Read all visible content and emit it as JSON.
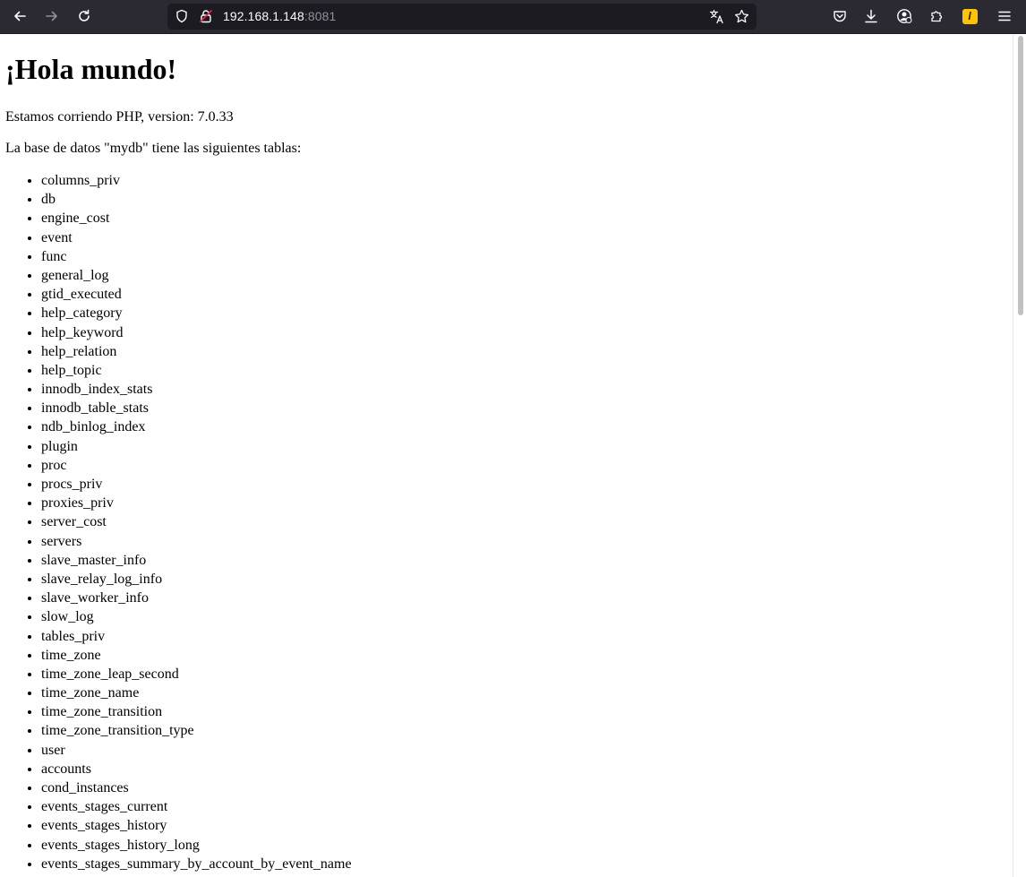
{
  "browser": {
    "url_host": "192.168.1.148",
    "url_port": ":8081",
    "icons": {
      "back": "back-arrow-icon",
      "forward": "forward-arrow-icon",
      "reload": "reload-icon",
      "tracking": "shield-icon",
      "lock": "lock-icon",
      "translate": "translate-icon",
      "bookmark": "star-icon",
      "pocket": "pocket-icon",
      "downloads": "download-icon",
      "account": "account-icon",
      "extensions": "puzzle-icon",
      "extension_badge": "l",
      "menu": "hamburger-menu-icon"
    },
    "colors": {
      "chrome_bg": "#2b2a33",
      "urlbar_bg": "#1c1b22",
      "icon": "#fbfbfe",
      "extension_accent": "#ffc300"
    }
  },
  "page": {
    "heading": "¡Hola mundo!",
    "php_version_text": "Estamos corriendo PHP, version: 7.0.33",
    "db_intro_text": "La base de datos \"mydb\" tiene las siguientes tablas:",
    "tables": [
      "columns_priv",
      "db",
      "engine_cost",
      "event",
      "func",
      "general_log",
      "gtid_executed",
      "help_category",
      "help_keyword",
      "help_relation",
      "help_topic",
      "innodb_index_stats",
      "innodb_table_stats",
      "ndb_binlog_index",
      "plugin",
      "proc",
      "procs_priv",
      "proxies_priv",
      "server_cost",
      "servers",
      "slave_master_info",
      "slave_relay_log_info",
      "slave_worker_info",
      "slow_log",
      "tables_priv",
      "time_zone",
      "time_zone_leap_second",
      "time_zone_name",
      "time_zone_transition",
      "time_zone_transition_type",
      "user",
      "accounts",
      "cond_instances",
      "events_stages_current",
      "events_stages_history",
      "events_stages_history_long",
      "events_stages_summary_by_account_by_event_name"
    ]
  }
}
